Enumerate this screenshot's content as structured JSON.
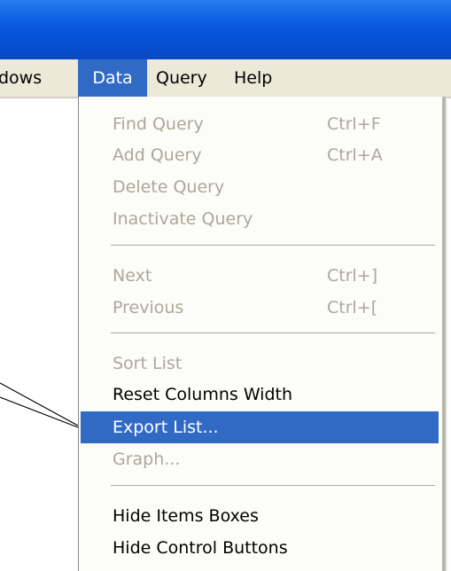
{
  "menubar": {
    "items": [
      {
        "label": "dows"
      },
      {
        "label": "Data"
      },
      {
        "label": "Query"
      },
      {
        "label": "Help"
      }
    ]
  },
  "data_menu": {
    "find_query": {
      "label": "Find Query",
      "shortcut": "Ctrl+F"
    },
    "add_query": {
      "label": "Add Query",
      "shortcut": "Ctrl+A"
    },
    "delete_query": {
      "label": "Delete Query"
    },
    "inactivate_query": {
      "label": "Inactivate Query"
    },
    "next": {
      "label": "Next",
      "shortcut": "Ctrl+]"
    },
    "previous": {
      "label": "Previous",
      "shortcut": "Ctrl+["
    },
    "sort_list": {
      "label": "Sort List"
    },
    "reset_columns_width": {
      "label": "Reset Columns Width"
    },
    "export_list": {
      "label": "Export List..."
    },
    "graph": {
      "label": "Graph..."
    },
    "hide_items_boxes": {
      "label": "Hide Items Boxes"
    },
    "hide_control_buttons": {
      "label": "Hide Control Buttons"
    }
  },
  "colors": {
    "title_bar": "#0a5ee0",
    "menubar_bg": "#ece9d8",
    "highlight": "#316ac5",
    "disabled_text": "#aca899"
  }
}
